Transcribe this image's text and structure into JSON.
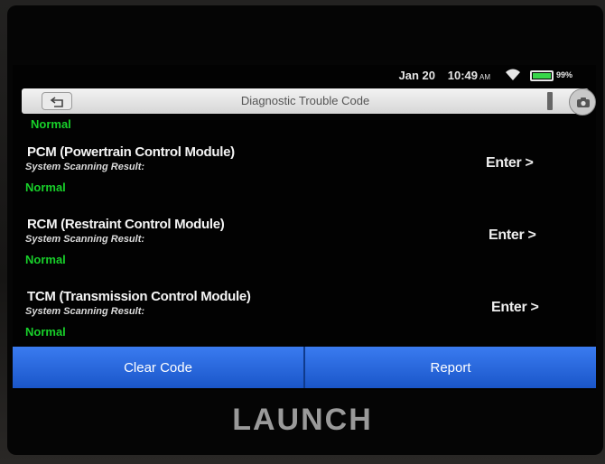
{
  "status_bar": {
    "date": "Jan 20",
    "time": "10:49",
    "time_suffix": "AM",
    "battery": "99%",
    "battery_level": 0.99
  },
  "title_bar": {
    "title": "Diagnostic Trouble Code"
  },
  "partial_item_status": "Normal",
  "modules": [
    {
      "title": "PCM (Powertrain Control Module)",
      "subtitle": "System Scanning Result:",
      "result": "Normal",
      "action": "Enter >"
    },
    {
      "title": "RCM (Restraint Control Module)",
      "subtitle": "System Scanning Result:",
      "result": "Normal",
      "action": "Enter >"
    },
    {
      "title": "TCM (Transmission Control Module)",
      "subtitle": "System Scanning Result:",
      "result": "Normal",
      "action": "Enter >"
    }
  ],
  "bottom_bar": {
    "clear_label": "Clear Code",
    "report_label": "Report"
  },
  "brand": "LAUNCH",
  "colors": {
    "result_green": "#18d02a",
    "button_blue": "#1d5fd8"
  }
}
